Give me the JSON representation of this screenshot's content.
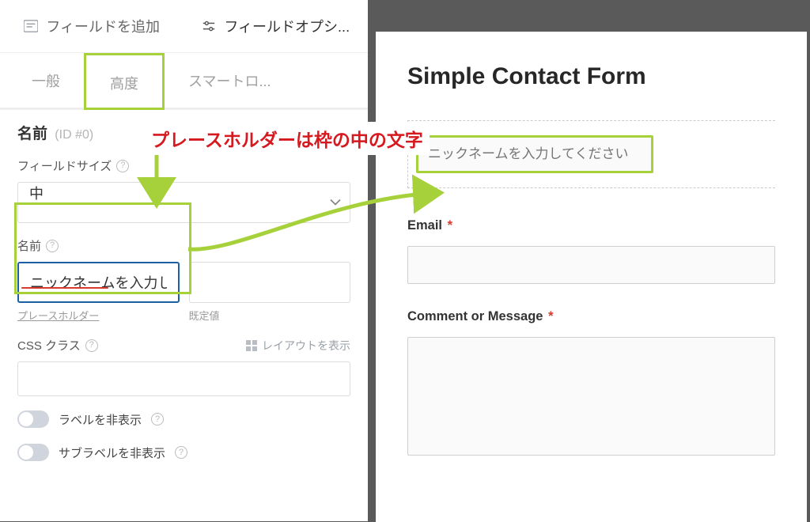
{
  "panel": {
    "topTabs": {
      "addField": "フィールドを追加",
      "fieldOptions": "フィールドオプシ..."
    },
    "subTabs": {
      "general": "一般",
      "advanced": "高度",
      "smartLogic": "スマートロ..."
    },
    "header": {
      "title": "名前",
      "id": "(ID #0)"
    },
    "fieldSize": {
      "label": "フィールドサイズ",
      "value": "中"
    },
    "nameSection": {
      "label": "名前",
      "placeholderValue": "ニックネームを入力して",
      "placeholderLabel": "プレースホルダー",
      "defaultLabel": "既定値"
    },
    "cssClass": {
      "label": "CSS クラス",
      "layoutLink": "レイアウトを表示"
    },
    "toggles": {
      "hideLabel": "ラベルを非表示",
      "hideSublabel": "サブラベルを非表示"
    }
  },
  "preview": {
    "title": "Simple Contact Form",
    "nicknamePlaceholder": "ニックネームを入力してください",
    "emailLabel": "Email",
    "commentLabel": "Comment or Message",
    "required": "*"
  },
  "annotation": "プレースホルダーは枠の中の文字",
  "colors": {
    "accent": "#a6d13b",
    "danger": "#d6181f",
    "focus": "#1b5fa7"
  }
}
